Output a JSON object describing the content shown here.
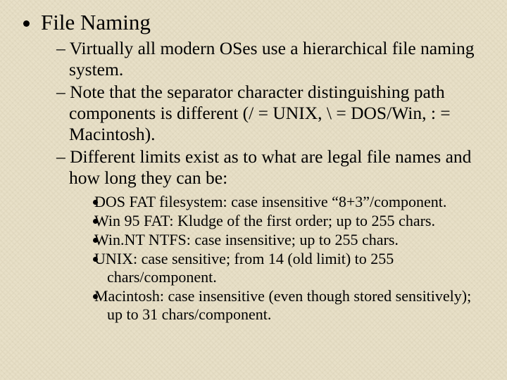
{
  "heading": "File Naming",
  "sub": [
    "Virtually all modern OSes use a hierarchical file naming system.",
    "Note that the separator character distinguishing path components is different (/ = UNIX, \\ = DOS/Win, : = Macintosh).",
    "Different limits exist as to what are legal file names and how long they can be:"
  ],
  "limits": [
    "DOS FAT filesystem: case insensitive “8+3”/component.",
    "Win 95 FAT: Kludge of the first order; up to 255 chars.",
    "Win.NT NTFS: case insensitive; up to 255 chars.",
    "UNIX: case sensitive; from 14 (old limit) to 255 chars/component.",
    "Macintosh: case insensitive (even though stored sensitively); up to 31 chars/component."
  ]
}
